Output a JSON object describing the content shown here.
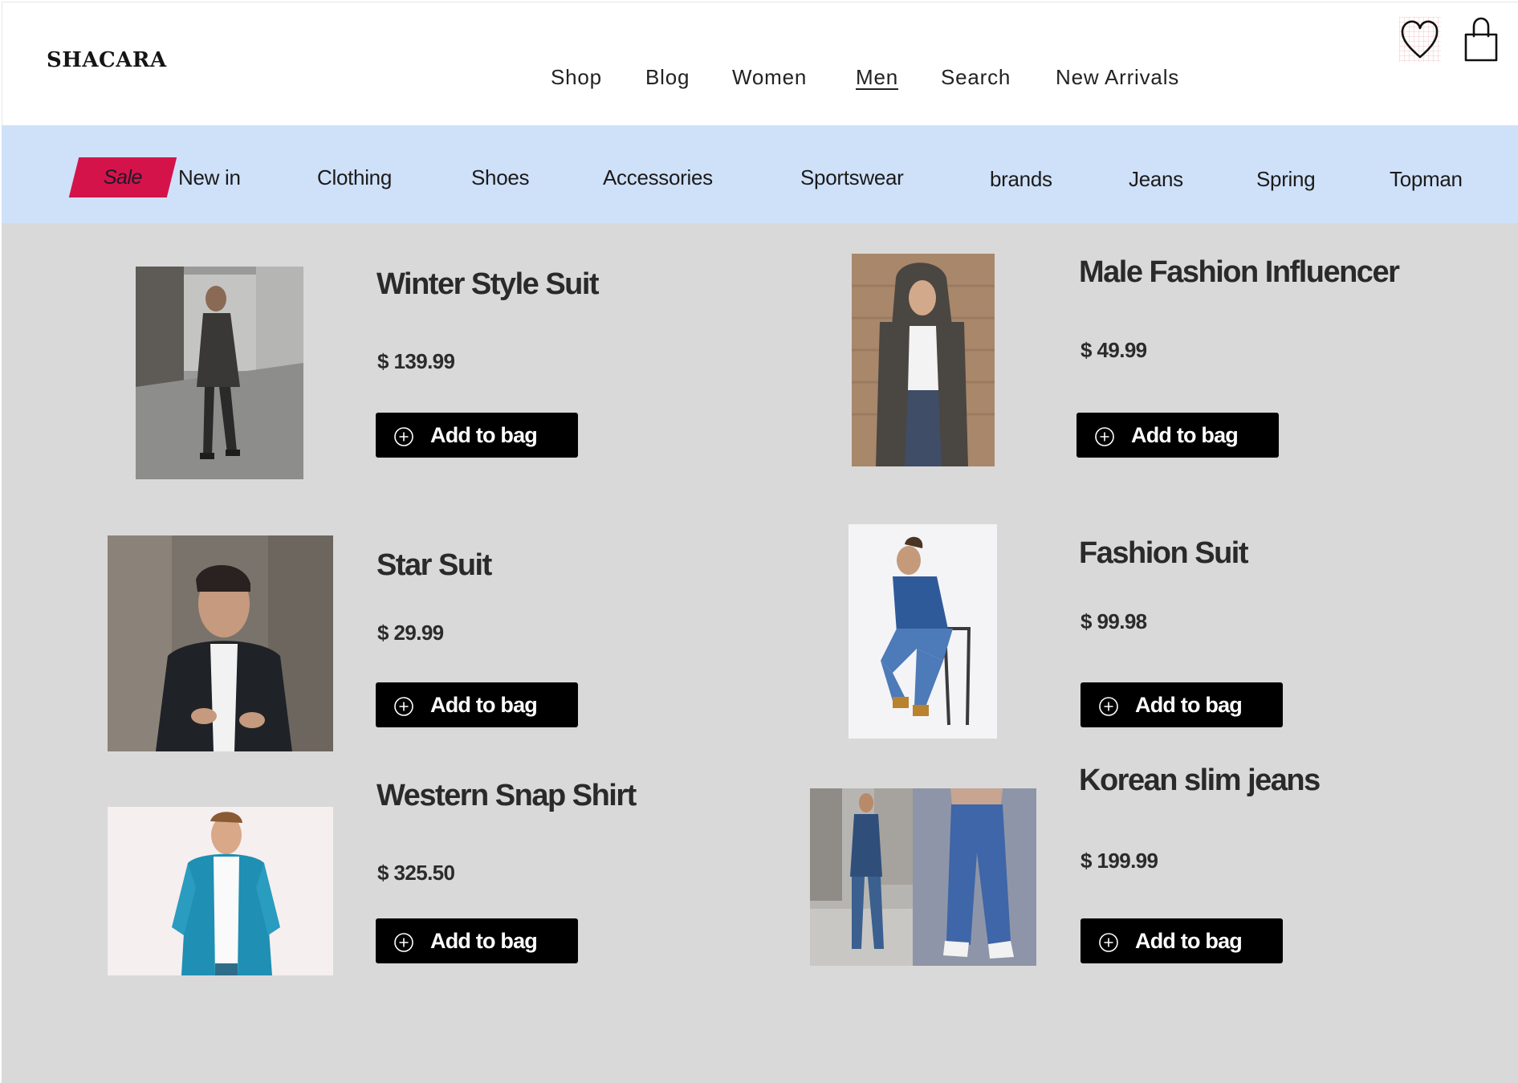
{
  "header": {
    "logo": "SHACARA",
    "nav": [
      {
        "label": "Shop"
      },
      {
        "label": "Blog"
      },
      {
        "label": "Women"
      },
      {
        "label": "Men",
        "active": true
      },
      {
        "label": "Search"
      },
      {
        "label": "New Arrivals"
      }
    ],
    "icons": [
      "heart-icon",
      "shopping-bag-icon"
    ]
  },
  "categories": {
    "sale_label": "Sale",
    "items": [
      "New in",
      "Clothing",
      "Shoes",
      "Accessories",
      "Sportswear",
      "brands",
      "Jeans",
      "Spring",
      "Topman"
    ]
  },
  "products": [
    {
      "title": "Winter Style Suit",
      "price": "$ 139.99",
      "button": "Add to bag"
    },
    {
      "title": "Male Fashion Influencer",
      "price": "$ 49.99",
      "button": "Add to bag"
    },
    {
      "title": "Star Suit",
      "price": "$ 29.99",
      "button": "Add to bag"
    },
    {
      "title": "Fashion Suit",
      "price": "$ 99.98",
      "button": "Add to bag"
    },
    {
      "title": "Western Snap Shirt",
      "price": "$ 325.50",
      "button": "Add to bag"
    },
    {
      "title": "Korean slim jeans",
      "price": "$ 199.99",
      "button": "Add to bag"
    }
  ],
  "colors": {
    "category_bar": "#cfe1f9",
    "sale_badge": "#d4134a",
    "content_bg": "#d9d9d9",
    "button_bg": "#000000"
  }
}
